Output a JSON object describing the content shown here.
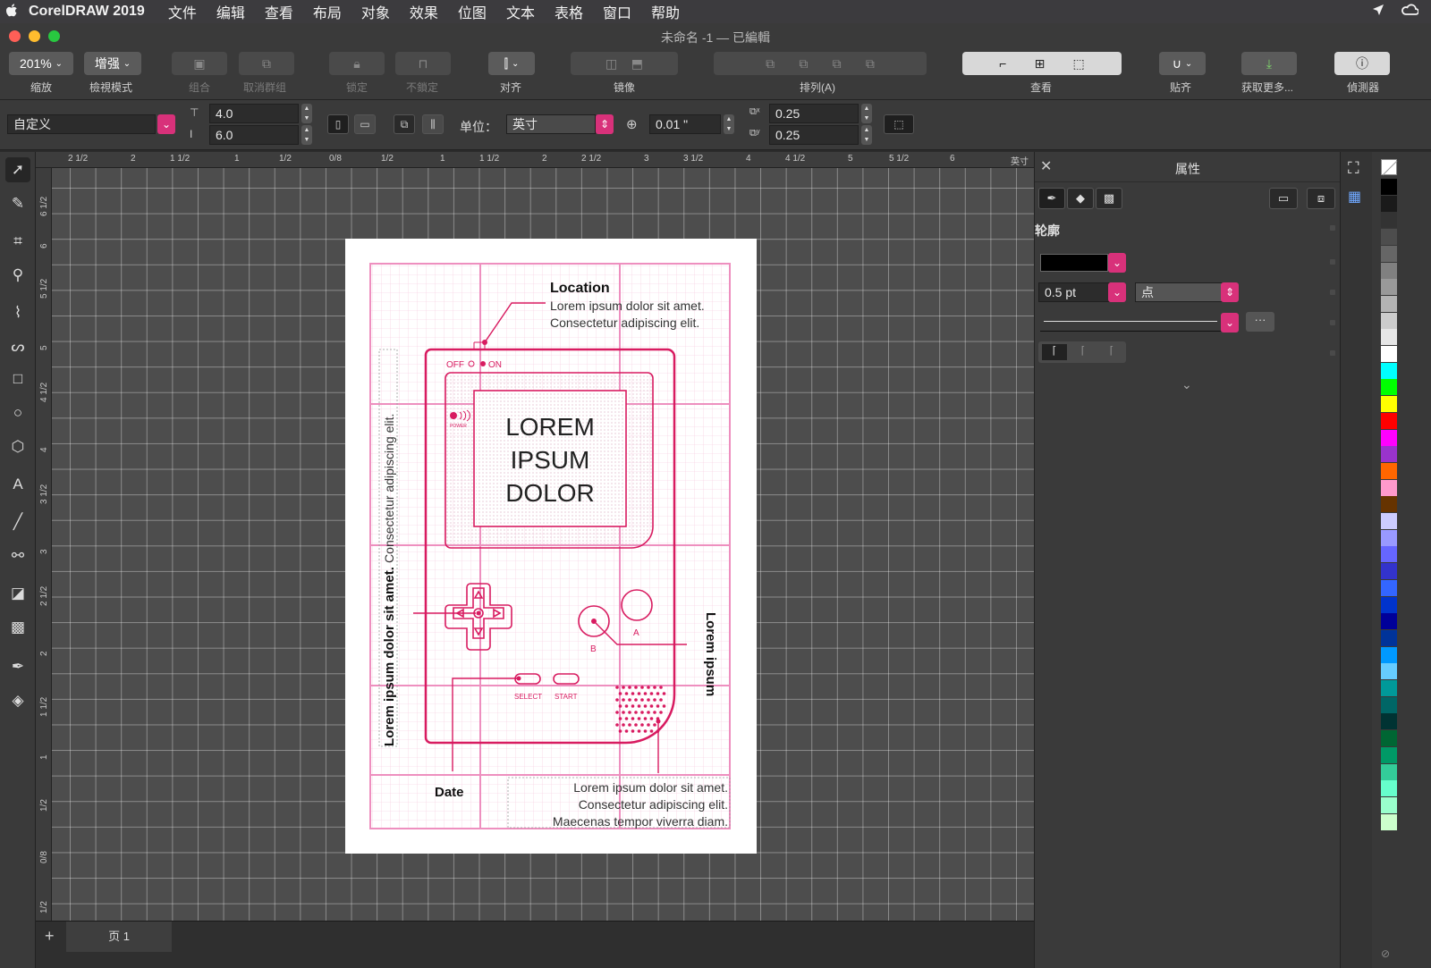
{
  "menubar": {
    "app_name": "CorelDRAW 2019",
    "items": [
      "文件",
      "编辑",
      "查看",
      "布局",
      "对象",
      "效果",
      "位图",
      "文本",
      "表格",
      "窗口",
      "帮助"
    ]
  },
  "window": {
    "title": "未命名 -1 — 已編輯"
  },
  "toolbar": {
    "zoom_value": "201%",
    "zoom_label": "缩放",
    "view_mode_value": "增强",
    "view_mode_label": "檢視模式",
    "group_label": "组合",
    "ungroup_label": "取消群组",
    "lock_label": "锁定",
    "unlock_label": "不鎖定",
    "align_label": "对齐",
    "mirror_label": "镜像",
    "arrange_label": "排列(A)",
    "view_label": "查看",
    "snap_label": "贴齐",
    "get_more_label": "获取更多...",
    "inspector_label": "偵測器"
  },
  "propbar": {
    "page_size_value": "自定义",
    "width_value": "4.0",
    "height_value": "6.0",
    "units_label": "单位：",
    "units_value": "英寸",
    "nudge_value": "0.01 \"",
    "dup_x_value": "0.25",
    "dup_y_value": "0.25"
  },
  "rulers": {
    "top": [
      "2 1/2",
      "2",
      "1 1/2",
      "1",
      "1/2",
      "0/8",
      "1/2",
      "1",
      "1 1/2",
      "2",
      "2 1/2",
      "3",
      "3 1/2",
      "4",
      "4 1/2",
      "5",
      "5 1/2",
      "6",
      "英寸"
    ],
    "left": [
      "6 1/2",
      "6",
      "5 1/2",
      "5",
      "4 1/2",
      "4",
      "3 1/2",
      "3",
      "2 1/2",
      "2",
      "1 1/2",
      "1",
      "1/2",
      "0/8",
      "1/2"
    ]
  },
  "artwork": {
    "location_title": "Location",
    "location_line1": "Lorem ipsum dolor sit amet.",
    "location_line2": "Consectetur adipiscing elit.",
    "power_off": "OFF",
    "power_on": "ON",
    "power_label": "POWER",
    "screen_line1": "LOREM",
    "screen_line2": "IPSUM",
    "screen_line3": "DOLOR",
    "left_vertical_bold": "Lorem ipsum dolor sit amet.",
    "left_vertical_light": "Consectetur adipiscing elit.",
    "right_vertical": "Lorem ipsum",
    "button_a": "A",
    "button_b": "B",
    "select_label": "SELECT",
    "start_label": "START",
    "date_label": "Date",
    "footer_line1": "Lorem ipsum dolor sit amet.",
    "footer_line2": "Consectetur adipiscing elit.",
    "footer_line3": "Maecenas tempor viverra diam.",
    "accent_color": "#d81b60"
  },
  "bottombar": {
    "add_page": "+",
    "page_tab": "页 1"
  },
  "properties_panel": {
    "title": "属性",
    "section_outline": "轮廓",
    "outline_color": "#000000",
    "outline_width": "0.5 pt",
    "outline_unit": "点"
  },
  "palette": {
    "colors": [
      "#000000",
      "#1a1a1a",
      "#333333",
      "#4d4d4d",
      "#666666",
      "#808080",
      "#999999",
      "#b3b3b3",
      "#cccccc",
      "#e6e6e6",
      "#ffffff",
      "#00ffff",
      "#00ff00",
      "#ffff00",
      "#ff0000",
      "#ff00ff",
      "#9933cc",
      "#ff6600",
      "#ff99cc",
      "#663300",
      "#ccccff",
      "#9999ff",
      "#6666ff",
      "#3333cc",
      "#3366ff",
      "#0033cc",
      "#000099",
      "#003399",
      "#0099ff",
      "#66ccff",
      "#009999",
      "#006666",
      "#003333",
      "#006633",
      "#009966",
      "#33cc99",
      "#66ffcc",
      "#99ffcc",
      "#ccffcc"
    ]
  }
}
